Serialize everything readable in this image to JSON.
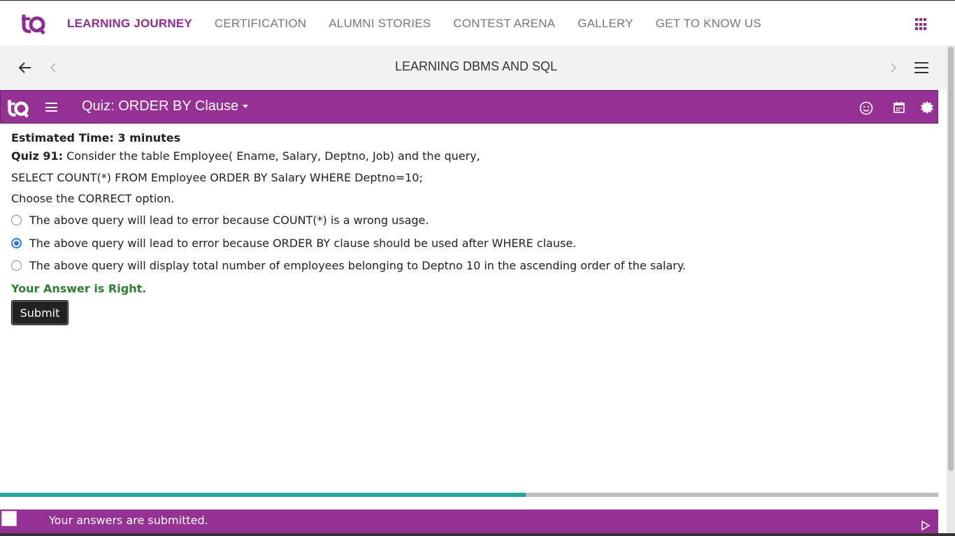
{
  "nav": {
    "items": [
      {
        "label": "LEARNING JOURNEY",
        "active": true
      },
      {
        "label": "CERTIFICATION"
      },
      {
        "label": "ALUMNI STORIES"
      },
      {
        "label": "CONTEST ARENA"
      },
      {
        "label": "GALLERY"
      },
      {
        "label": "GET TO KNOW US"
      }
    ]
  },
  "course": {
    "title": "LEARNING DBMS AND SQL"
  },
  "quiz_header": {
    "title": "Quiz: ORDER BY Clause"
  },
  "quiz": {
    "estimated_time": "Estimated Time: 3 minutes",
    "number_label": "Quiz 91:",
    "question": " Consider the table Employee( Ename, Salary, Deptno, Job) and the query,",
    "query": "SELECT COUNT(*) FROM Employee ORDER BY Salary WHERE Deptno=10;",
    "instruction": "Choose the CORRECT option.",
    "options": [
      {
        "text": "The above query will lead to error because COUNT(*) is a wrong usage.",
        "selected": false
      },
      {
        "text": "The above query will lead to error because ORDER BY clause should be used after WHERE clause.",
        "selected": true
      },
      {
        "text": "The above query will display total number of employees belonging to Deptno 10 in the ascending order of the salary.",
        "selected": false
      }
    ],
    "result": "Your Answer is Right.",
    "submit_label": "Submit"
  },
  "progress": {
    "fraction": 0.56
  },
  "footer": {
    "status": "Your answers are submitted."
  },
  "colors": {
    "brand": "#953195",
    "progress": "#26a69a",
    "correct": "#2e7d32",
    "radio": "#2a7ae2"
  },
  "icons": [
    "apps-grid-icon",
    "back-arrow-icon",
    "prev-chevron-icon",
    "next-chevron-icon",
    "menu-icon",
    "smiley-icon",
    "calendar-icon",
    "gear-icon",
    "play-icon"
  ]
}
